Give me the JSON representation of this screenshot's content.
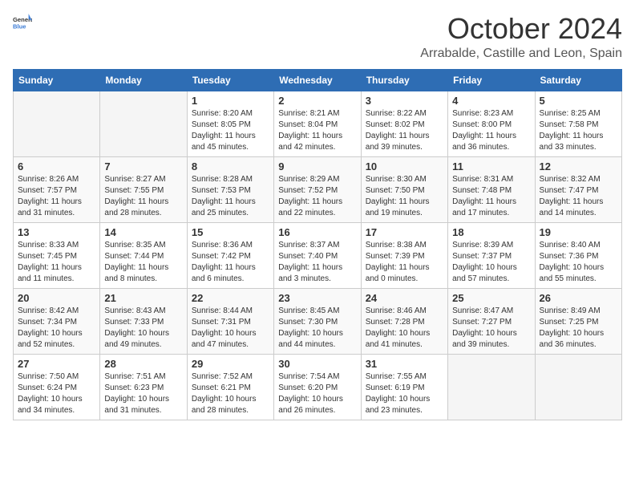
{
  "header": {
    "logo_general": "General",
    "logo_blue": "Blue",
    "month": "October 2024",
    "location": "Arrabalde, Castille and Leon, Spain"
  },
  "weekdays": [
    "Sunday",
    "Monday",
    "Tuesday",
    "Wednesday",
    "Thursday",
    "Friday",
    "Saturday"
  ],
  "weeks": [
    [
      {
        "day": "",
        "empty": true
      },
      {
        "day": "",
        "empty": true
      },
      {
        "day": "1",
        "sunrise": "8:20 AM",
        "sunset": "8:05 PM",
        "daylight": "11 hours and 45 minutes."
      },
      {
        "day": "2",
        "sunrise": "8:21 AM",
        "sunset": "8:04 PM",
        "daylight": "11 hours and 42 minutes."
      },
      {
        "day": "3",
        "sunrise": "8:22 AM",
        "sunset": "8:02 PM",
        "daylight": "11 hours and 39 minutes."
      },
      {
        "day": "4",
        "sunrise": "8:23 AM",
        "sunset": "8:00 PM",
        "daylight": "11 hours and 36 minutes."
      },
      {
        "day": "5",
        "sunrise": "8:25 AM",
        "sunset": "7:58 PM",
        "daylight": "11 hours and 33 minutes."
      }
    ],
    [
      {
        "day": "6",
        "sunrise": "8:26 AM",
        "sunset": "7:57 PM",
        "daylight": "11 hours and 31 minutes."
      },
      {
        "day": "7",
        "sunrise": "8:27 AM",
        "sunset": "7:55 PM",
        "daylight": "11 hours and 28 minutes."
      },
      {
        "day": "8",
        "sunrise": "8:28 AM",
        "sunset": "7:53 PM",
        "daylight": "11 hours and 25 minutes."
      },
      {
        "day": "9",
        "sunrise": "8:29 AM",
        "sunset": "7:52 PM",
        "daylight": "11 hours and 22 minutes."
      },
      {
        "day": "10",
        "sunrise": "8:30 AM",
        "sunset": "7:50 PM",
        "daylight": "11 hours and 19 minutes."
      },
      {
        "day": "11",
        "sunrise": "8:31 AM",
        "sunset": "7:48 PM",
        "daylight": "11 hours and 17 minutes."
      },
      {
        "day": "12",
        "sunrise": "8:32 AM",
        "sunset": "7:47 PM",
        "daylight": "11 hours and 14 minutes."
      }
    ],
    [
      {
        "day": "13",
        "sunrise": "8:33 AM",
        "sunset": "7:45 PM",
        "daylight": "11 hours and 11 minutes."
      },
      {
        "day": "14",
        "sunrise": "8:35 AM",
        "sunset": "7:44 PM",
        "daylight": "11 hours and 8 minutes."
      },
      {
        "day": "15",
        "sunrise": "8:36 AM",
        "sunset": "7:42 PM",
        "daylight": "11 hours and 6 minutes."
      },
      {
        "day": "16",
        "sunrise": "8:37 AM",
        "sunset": "7:40 PM",
        "daylight": "11 hours and 3 minutes."
      },
      {
        "day": "17",
        "sunrise": "8:38 AM",
        "sunset": "7:39 PM",
        "daylight": "11 hours and 0 minutes."
      },
      {
        "day": "18",
        "sunrise": "8:39 AM",
        "sunset": "7:37 PM",
        "daylight": "10 hours and 57 minutes."
      },
      {
        "day": "19",
        "sunrise": "8:40 AM",
        "sunset": "7:36 PM",
        "daylight": "10 hours and 55 minutes."
      }
    ],
    [
      {
        "day": "20",
        "sunrise": "8:42 AM",
        "sunset": "7:34 PM",
        "daylight": "10 hours and 52 minutes."
      },
      {
        "day": "21",
        "sunrise": "8:43 AM",
        "sunset": "7:33 PM",
        "daylight": "10 hours and 49 minutes."
      },
      {
        "day": "22",
        "sunrise": "8:44 AM",
        "sunset": "7:31 PM",
        "daylight": "10 hours and 47 minutes."
      },
      {
        "day": "23",
        "sunrise": "8:45 AM",
        "sunset": "7:30 PM",
        "daylight": "10 hours and 44 minutes."
      },
      {
        "day": "24",
        "sunrise": "8:46 AM",
        "sunset": "7:28 PM",
        "daylight": "10 hours and 41 minutes."
      },
      {
        "day": "25",
        "sunrise": "8:47 AM",
        "sunset": "7:27 PM",
        "daylight": "10 hours and 39 minutes."
      },
      {
        "day": "26",
        "sunrise": "8:49 AM",
        "sunset": "7:25 PM",
        "daylight": "10 hours and 36 minutes."
      }
    ],
    [
      {
        "day": "27",
        "sunrise": "7:50 AM",
        "sunset": "6:24 PM",
        "daylight": "10 hours and 34 minutes."
      },
      {
        "day": "28",
        "sunrise": "7:51 AM",
        "sunset": "6:23 PM",
        "daylight": "10 hours and 31 minutes."
      },
      {
        "day": "29",
        "sunrise": "7:52 AM",
        "sunset": "6:21 PM",
        "daylight": "10 hours and 28 minutes."
      },
      {
        "day": "30",
        "sunrise": "7:54 AM",
        "sunset": "6:20 PM",
        "daylight": "10 hours and 26 minutes."
      },
      {
        "day": "31",
        "sunrise": "7:55 AM",
        "sunset": "6:19 PM",
        "daylight": "10 hours and 23 minutes."
      },
      {
        "day": "",
        "empty": true
      },
      {
        "day": "",
        "empty": true
      }
    ]
  ]
}
